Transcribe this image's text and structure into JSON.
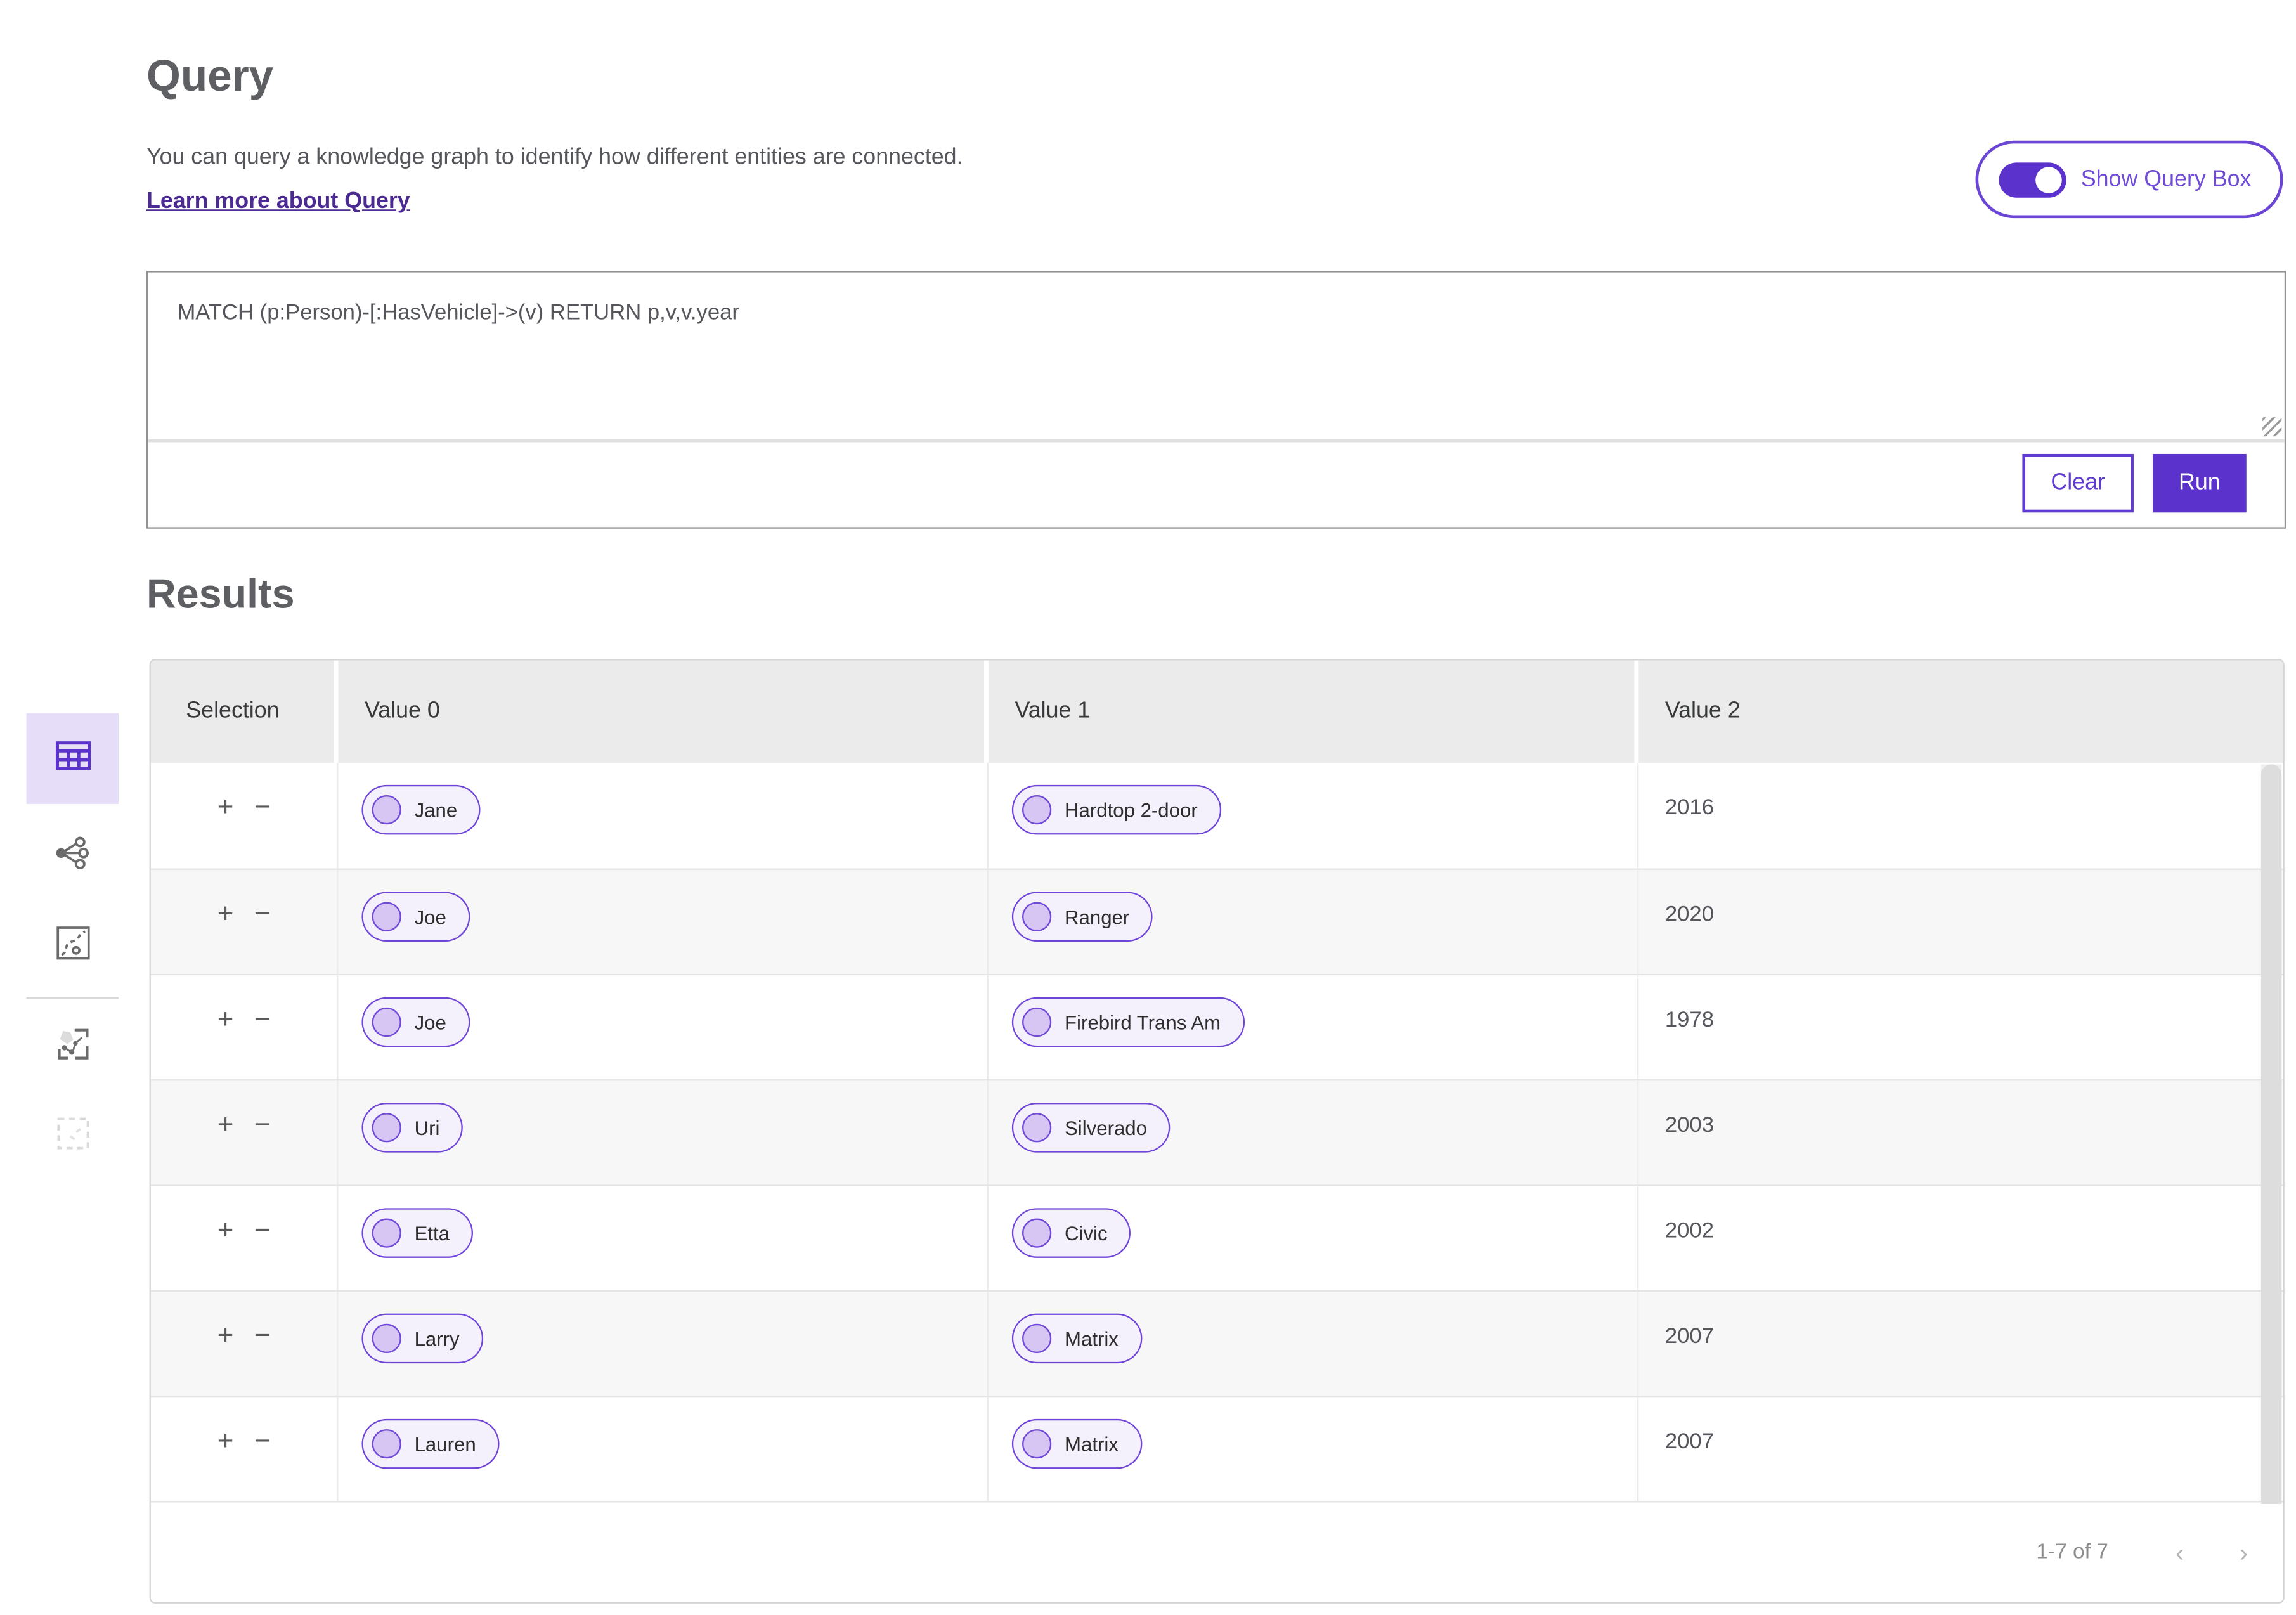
{
  "page": {
    "title": "Query",
    "description": "You can query a knowledge graph to identify how different entities are connected.",
    "learn_more_label": "Learn more about Query"
  },
  "toggle": {
    "label": "Show Query Box",
    "state_on": true
  },
  "query_box": {
    "query_text": "MATCH (p:Person)-[:HasVehicle]->(v) RETURN p,v,v.year",
    "clear_label": "Clear",
    "run_label": "Run"
  },
  "results": {
    "title": "Results",
    "plus_label": "+",
    "minus_label": "−",
    "columns": [
      "Selection",
      "Value 0",
      "Value 1",
      "Value 2"
    ],
    "rows": [
      {
        "value0": "Jane",
        "value1": "Hardtop 2-door",
        "value2": "2016"
      },
      {
        "value0": "Joe",
        "value1": "Ranger",
        "value2": "2020"
      },
      {
        "value0": "Joe",
        "value1": "Firebird Trans Am",
        "value2": "1978"
      },
      {
        "value0": "Uri",
        "value1": "Silverado",
        "value2": "2003"
      },
      {
        "value0": "Etta",
        "value1": "Civic",
        "value2": "2002"
      },
      {
        "value0": "Larry",
        "value1": "Matrix",
        "value2": "2007"
      },
      {
        "value0": "Lauren",
        "value1": "Matrix",
        "value2": "2007"
      }
    ],
    "pagination": {
      "range_label": "1-7 of 7",
      "prev_icon": "‹",
      "next_icon": "›"
    }
  },
  "sidebar": {
    "items": [
      {
        "name": "table-view",
        "selected": true,
        "disabled": false
      },
      {
        "name": "graph-view",
        "selected": false,
        "disabled": false
      },
      {
        "name": "map-view",
        "selected": false,
        "disabled": false
      },
      {
        "name": "graph-selection-view",
        "selected": false,
        "disabled": false
      },
      {
        "name": "selection-tool",
        "selected": false,
        "disabled": true
      }
    ]
  },
  "colors": {
    "accent_purple": "#5b33cc",
    "pill_border": "#6e44d9",
    "pill_background": "#f4f1fc",
    "pill_dot": "#d7c6f4",
    "link_purple": "#4b2a91",
    "selected_icon_background": "#e6def8",
    "header_background": "#ebebeb",
    "alt_row_background": "#f7f7f7"
  }
}
